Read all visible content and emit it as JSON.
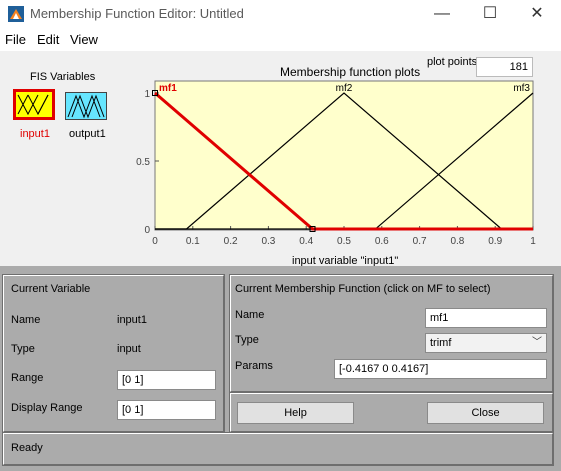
{
  "window": {
    "title": "Membership Function Editor: Untitled"
  },
  "menu": {
    "file": "File",
    "edit": "Edit",
    "view": "View"
  },
  "fis": {
    "title": "FIS Variables",
    "input_label": "input1",
    "output_label": "output1"
  },
  "plot": {
    "title": "Membership function plots",
    "plot_points_label": "plot points:",
    "plot_points_value": "181",
    "xlabel": "input variable \"input1\"",
    "colors": {
      "background": "#ffffcc",
      "selected": "#e00000",
      "unselected": "#000000"
    }
  },
  "chart_data": {
    "type": "line",
    "title": "Membership function plots",
    "xlabel": "input variable \"input1\"",
    "ylabel": "",
    "xlim": [
      0,
      1
    ],
    "ylim": [
      0,
      1
    ],
    "xticks": [
      "0",
      "0.1",
      "0.2",
      "0.3",
      "0.4",
      "0.5",
      "0.6",
      "0.7",
      "0.8",
      "0.9",
      "1"
    ],
    "yticks": [
      "0",
      "0.5",
      "1"
    ],
    "series": [
      {
        "name": "mf1",
        "x": [
          0,
          0,
          0.4167,
          1
        ],
        "y": [
          1,
          1,
          0,
          0
        ],
        "selected": true
      },
      {
        "name": "mf2",
        "x": [
          0,
          0.0833,
          0.5,
          0.9167,
          1
        ],
        "y": [
          0,
          0,
          1,
          0,
          0
        ],
        "selected": false
      },
      {
        "name": "mf3",
        "x": [
          0,
          0.5833,
          1
        ],
        "y": [
          0,
          0,
          1
        ],
        "selected": false
      }
    ]
  },
  "current_variable": {
    "title": "Current Variable",
    "name_label": "Name",
    "name_value": "input1",
    "type_label": "Type",
    "type_value": "input",
    "range_label": "Range",
    "range_value": "[0 1]",
    "display_range_label": "Display Range",
    "display_range_value": "[0 1]"
  },
  "current_mf": {
    "title": "Current Membership Function (click on MF to select)",
    "name_label": "Name",
    "name_value": "mf1",
    "type_label": "Type",
    "type_value": "trimf",
    "params_label": "Params",
    "params_value": "[-0.4167 0 0.4167]"
  },
  "buttons": {
    "help": "Help",
    "close": "Close"
  },
  "status": {
    "text": "Ready"
  }
}
